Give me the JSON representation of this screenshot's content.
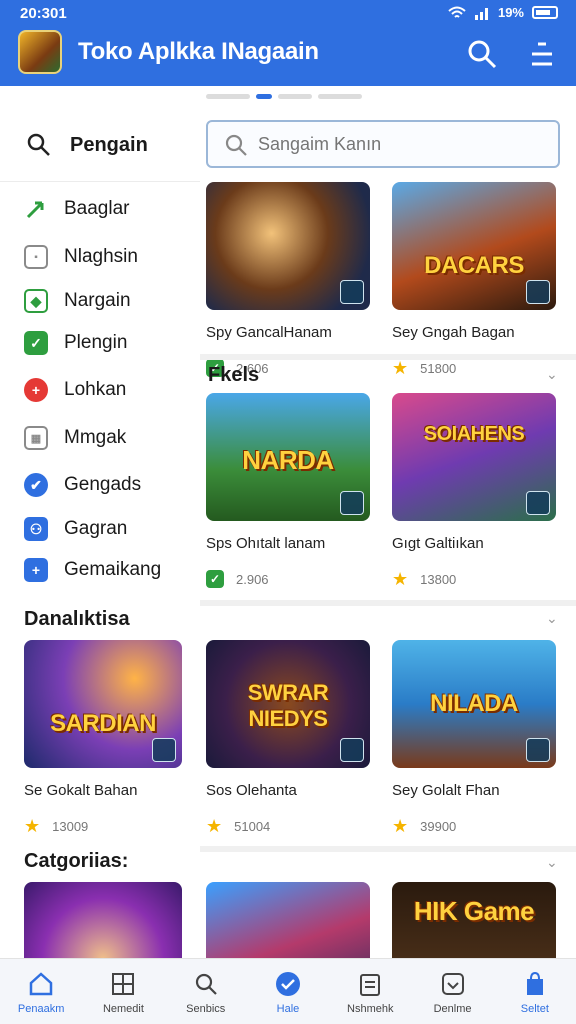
{
  "status_bar": {
    "time": "20:301",
    "battery": "19%"
  },
  "header": {
    "title": "Toko Aplkka INagaain"
  },
  "sidebar": {
    "search_label": "Pengain",
    "items": [
      {
        "label": "Baaglar",
        "color": "#2e9e3f",
        "icon": "leaf-icon"
      },
      {
        "label": "Nlaghsin",
        "color": "#8a8a8a",
        "icon": "image-icon"
      },
      {
        "label": "Nargain",
        "color": "#2e9e3f",
        "icon": "tile-icon"
      },
      {
        "label": "Plengin",
        "color": "#2e9e3f",
        "icon": "check-tile-icon"
      },
      {
        "label": "Lohkan",
        "color": "#e53935",
        "icon": "plus-circle-icon"
      },
      {
        "label": "Mmgak",
        "color": "#8a8a8a",
        "icon": "grid-icon"
      },
      {
        "label": "Gengads",
        "color": "#2f6fe0",
        "icon": "compass-icon"
      },
      {
        "label": "Gagran",
        "color": "#2f6fe0",
        "icon": "people-icon"
      },
      {
        "label": "Gemaikang",
        "color": "#2f6fe0",
        "icon": "plus-tile-icon"
      }
    ]
  },
  "search": {
    "placeholder": "Sangaim Kanın"
  },
  "sections": {
    "featured": {
      "title": "Fkels"
    },
    "popular": {
      "title": "Danalıktisa"
    },
    "categories": {
      "title": "Catgoriias:"
    }
  },
  "apps": {
    "row1": [
      {
        "name": "Spy GancalHanam",
        "rating": "2.606",
        "badge": "check"
      },
      {
        "name": "Sey Gngah Bagan",
        "rating": "51800",
        "badge": "star"
      }
    ],
    "row2": [
      {
        "name": "Sps Ohıtalt lanam",
        "rating": "2.906",
        "badge": "check"
      },
      {
        "name": "Gıgt Galtiıkan",
        "rating": "13800",
        "badge": "star"
      }
    ],
    "row3": [
      {
        "name": "Se Gokalt Bahan",
        "rating": "13009",
        "badge": "star"
      },
      {
        "name": "Sos Olehanta",
        "rating": "51004",
        "badge": "star"
      },
      {
        "name": "Sey Golalt Fhan",
        "rating": "39900",
        "badge": "star"
      }
    ]
  },
  "thumb_text": {
    "r1a": "",
    "r1b": "DACARS",
    "r2a": "NARDA",
    "r2b": "SOIAHENS",
    "r3a": "SARDIAN",
    "r3b": "SWRAR NIEDYS",
    "r3c": "NILADA",
    "r4c": "HIK Game"
  },
  "bottom_nav": [
    {
      "label": "Penaakm",
      "icon": "home-icon"
    },
    {
      "label": "Nemedit",
      "icon": "grid-apps-icon"
    },
    {
      "label": "Senbics",
      "icon": "search-icon"
    },
    {
      "label": "Hale",
      "icon": "check-circle-icon"
    },
    {
      "label": "Nshmehk",
      "icon": "clipboard-icon"
    },
    {
      "label": "Denlme",
      "icon": "download-icon"
    },
    {
      "label": "Seltet",
      "icon": "bag-icon"
    }
  ],
  "colors": {
    "primary": "#2f6fe0",
    "accent_gold": "#ffd23f",
    "star": "#f5b400",
    "check": "#2e9e3f"
  }
}
